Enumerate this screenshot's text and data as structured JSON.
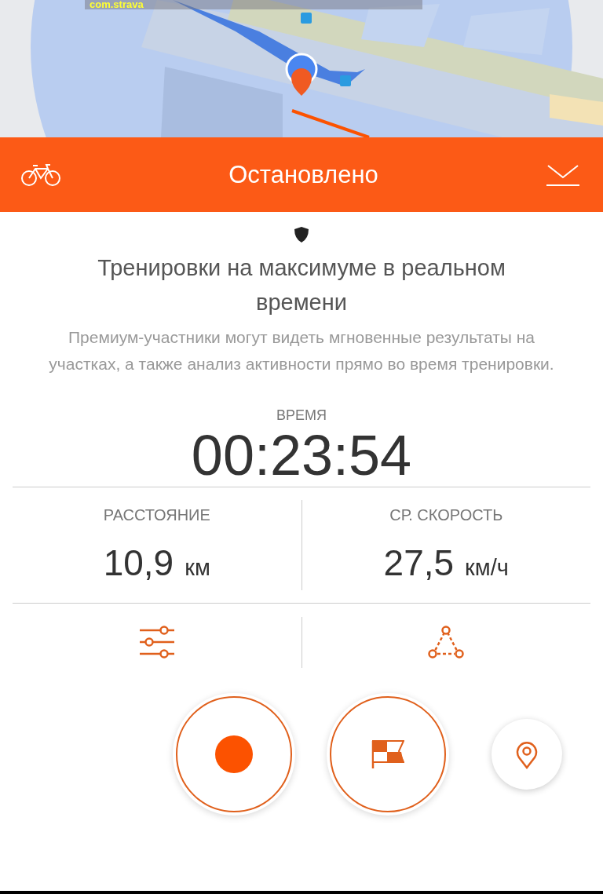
{
  "overlay_label": "com.strava",
  "header": {
    "title": "Остановлено"
  },
  "promo": {
    "title": "Тренировки на максимуме в реальном времени",
    "text": "Премиум-участники могут видеть мгновенные результаты на участках, а также анализ активности прямо во время тренировки."
  },
  "time": {
    "label": "ВРЕМЯ",
    "value": "00:23:54"
  },
  "stats": [
    {
      "label": "РАССТОЯНИЕ",
      "value": "10,9",
      "unit": "км"
    },
    {
      "label": "СР. СКОРОСТЬ",
      "value": "27,5",
      "unit": "км/ч"
    }
  ],
  "tools": [
    {
      "kind": "sensors"
    },
    {
      "kind": "route"
    }
  ],
  "controls": [
    {
      "kind": "record"
    },
    {
      "kind": "lap"
    },
    {
      "kind": "location"
    }
  ]
}
